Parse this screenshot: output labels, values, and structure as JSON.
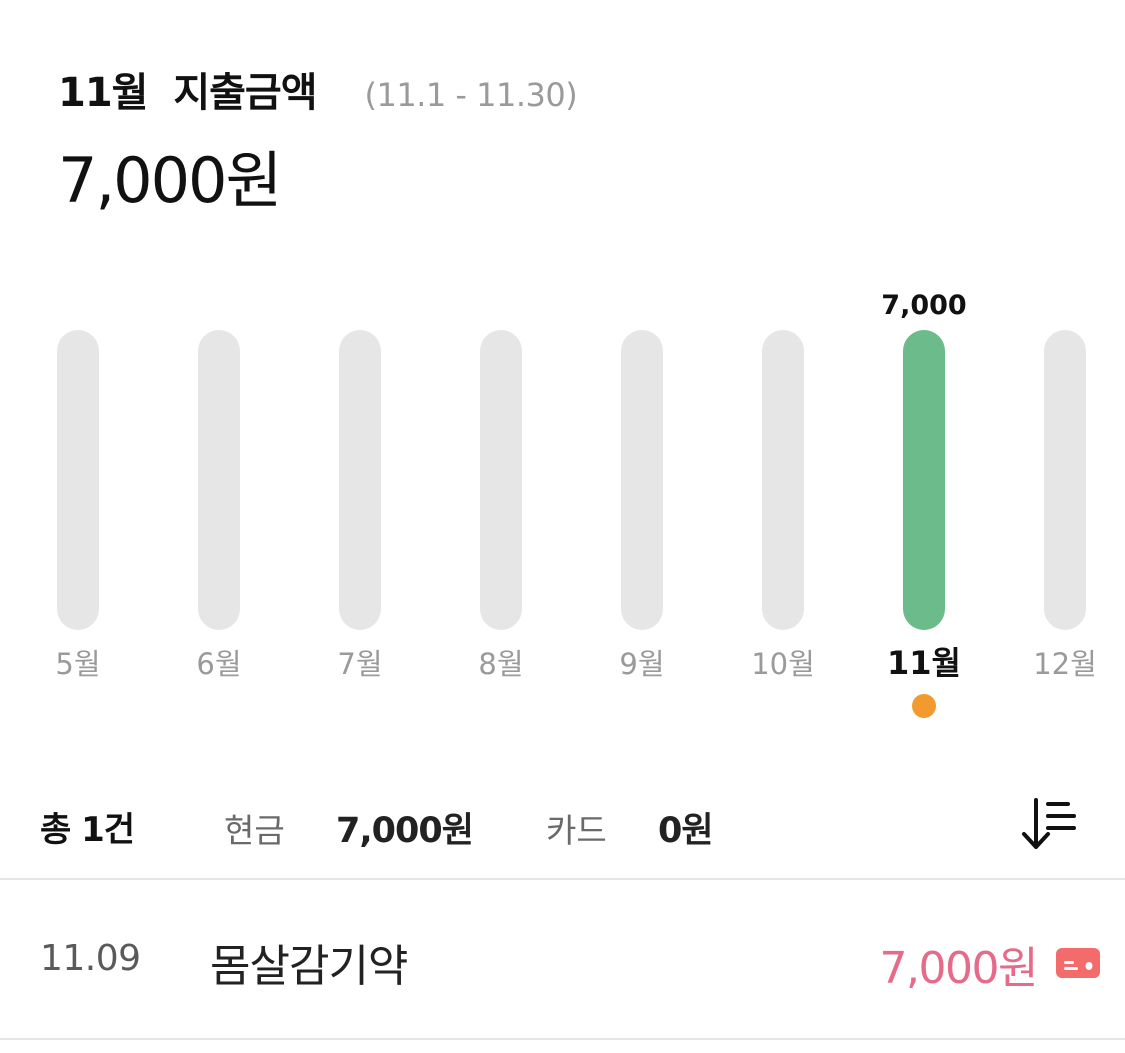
{
  "header": {
    "title": "11월  지출금액",
    "range": "(11.1 - 11.30)",
    "total": "7,000원"
  },
  "chart_data": {
    "type": "bar",
    "categories": [
      "5월",
      "6월",
      "7월",
      "8월",
      "9월",
      "10월",
      "11월",
      "12월"
    ],
    "values": [
      0,
      0,
      0,
      0,
      0,
      0,
      7000,
      0
    ],
    "value_labels": [
      "",
      "",
      "",
      "",
      "",
      "",
      "7,000",
      ""
    ],
    "selected_index": 6,
    "bar_color_inactive": "#e6e6e6",
    "bar_color_active": "#6cbb8a",
    "selected_dot_color": "#f29a2e",
    "title": "",
    "xlabel": "",
    "ylabel": ""
  },
  "summary": {
    "total_label": "총 1건",
    "cash_label": "현금",
    "cash_value": "7,000원",
    "card_label": "카드",
    "card_value": "0원",
    "sort_icon": "sort-descending-icon"
  },
  "transactions": [
    {
      "date": "11.09",
      "name": "몸살감기약",
      "amount": "7,000원",
      "amount_color": "#e66b8a",
      "icon": "card-payment-icon",
      "icon_color": "#f46b6b"
    }
  ]
}
